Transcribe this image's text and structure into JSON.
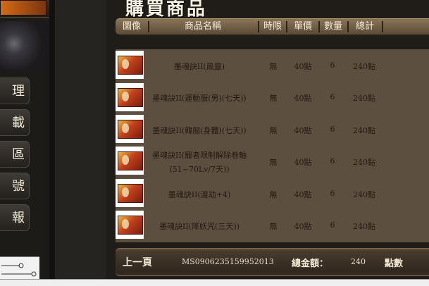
{
  "left_nav": {
    "buttons": [
      "理",
      "載",
      "區",
      "號",
      "報"
    ]
  },
  "page": {
    "title": "購買商品"
  },
  "table": {
    "headers": [
      "圖像",
      "商品名稱",
      "時限",
      "單價",
      "數量",
      "總計"
    ],
    "rows": [
      {
        "name": "墨魂訣II(鳳靈)",
        "name2": "",
        "time": "無",
        "price": "40點",
        "qty": "6",
        "total": "240點"
      },
      {
        "name": "墨魂訣II(運動服(男)(七天))",
        "name2": "",
        "time": "無",
        "price": "40點",
        "qty": "6",
        "total": "240點"
      },
      {
        "name": "墨魂訣II(韓服(身體)(七天))",
        "name2": "",
        "time": "無",
        "price": "40點",
        "qty": "6",
        "total": "240點"
      },
      {
        "name": "墨魂訣II(寵者限制解除卷軸",
        "name2": "(51~70Lv/7天))",
        "time": "無",
        "price": "40點",
        "qty": "6",
        "total": "240點"
      },
      {
        "name": "墨魂訣II(渡劫+4)",
        "name2": "",
        "time": "無",
        "price": "40點",
        "qty": "6",
        "total": "240點"
      },
      {
        "name": "墨魂訣II(降妖咒(三天))",
        "name2": "",
        "time": "無",
        "price": "40點",
        "qty": "6",
        "total": "240點"
      }
    ]
  },
  "footer": {
    "prev_label": "上一頁",
    "order_code": "MS0906235159952013",
    "total_label": "總金額：",
    "total_value": "240",
    "total_unit": "點數"
  }
}
